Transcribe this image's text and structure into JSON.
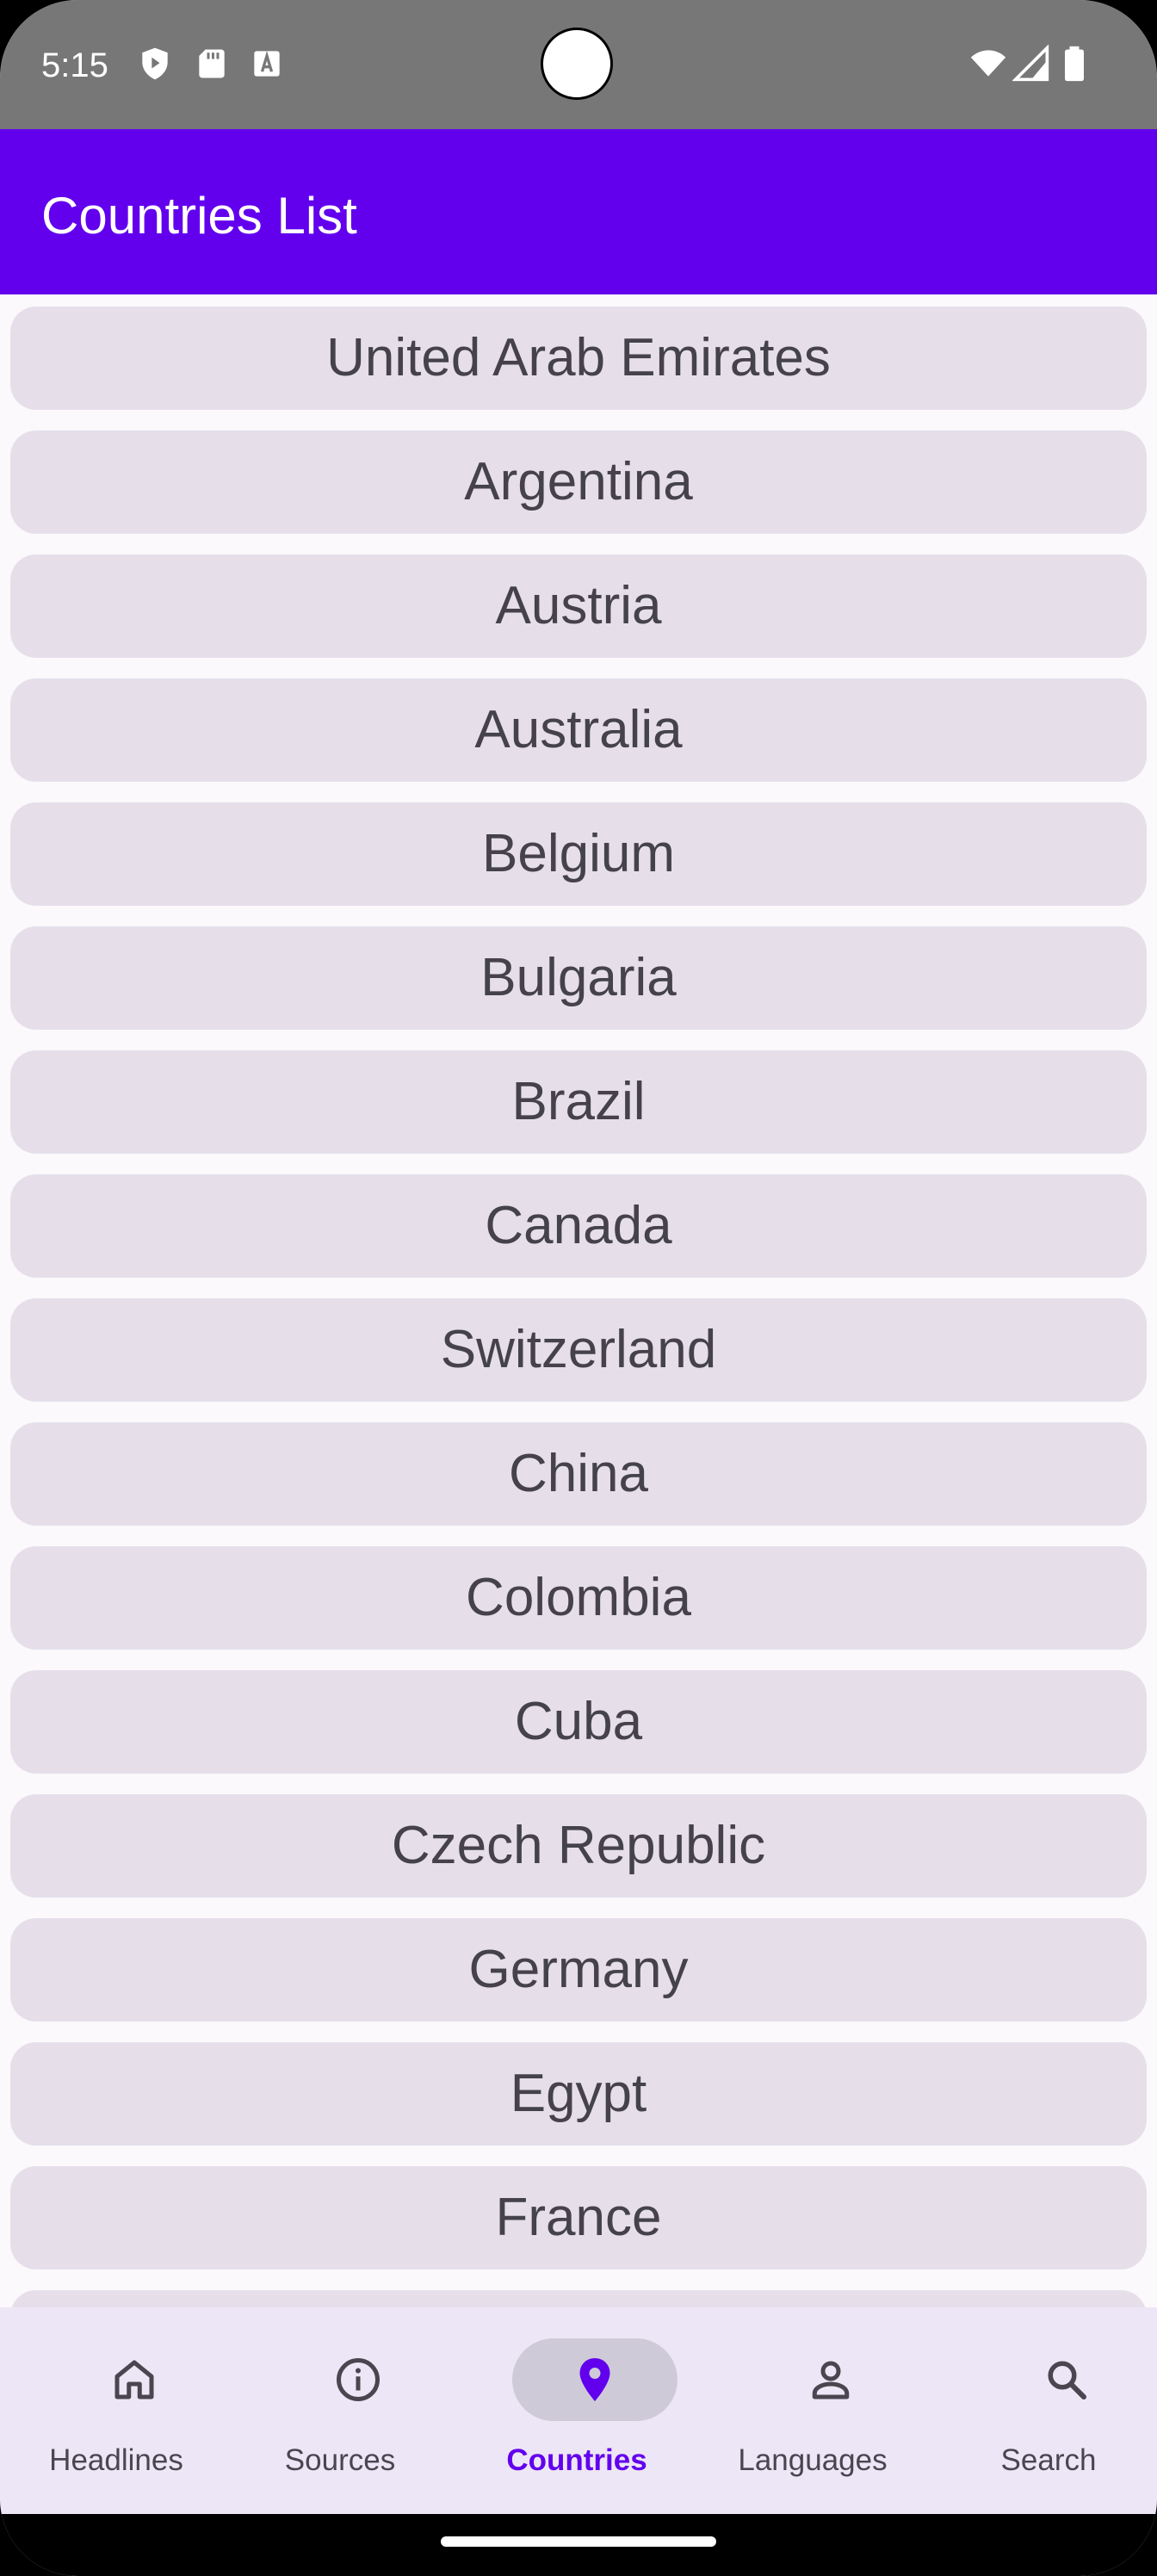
{
  "status_bar": {
    "time": "5:15",
    "left_icons": [
      "shield-play-icon",
      "sd-card-icon",
      "font-icon"
    ],
    "right_icons": [
      "wifi-icon",
      "signal-icon",
      "battery-icon"
    ]
  },
  "app_bar": {
    "title": "Countries List",
    "color": "#6200ee"
  },
  "countries": [
    "United Arab Emirates",
    "Argentina",
    "Austria",
    "Australia",
    "Belgium",
    "Bulgaria",
    "Brazil",
    "Canada",
    "Switzerland",
    "China",
    "Colombia",
    "Cuba",
    "Czech Republic",
    "Germany",
    "Egypt",
    "France",
    ""
  ],
  "bottom_nav": {
    "items": [
      {
        "label": "Headlines",
        "icon": "home-icon",
        "active": false
      },
      {
        "label": "Sources",
        "icon": "info-icon",
        "active": false
      },
      {
        "label": "Countries",
        "icon": "location-pin-icon",
        "active": true
      },
      {
        "label": "Languages",
        "icon": "person-icon",
        "active": false
      },
      {
        "label": "Search",
        "icon": "search-icon",
        "active": false
      }
    ],
    "active_color": "#6200ee",
    "inactive_color": "#4a4650"
  }
}
